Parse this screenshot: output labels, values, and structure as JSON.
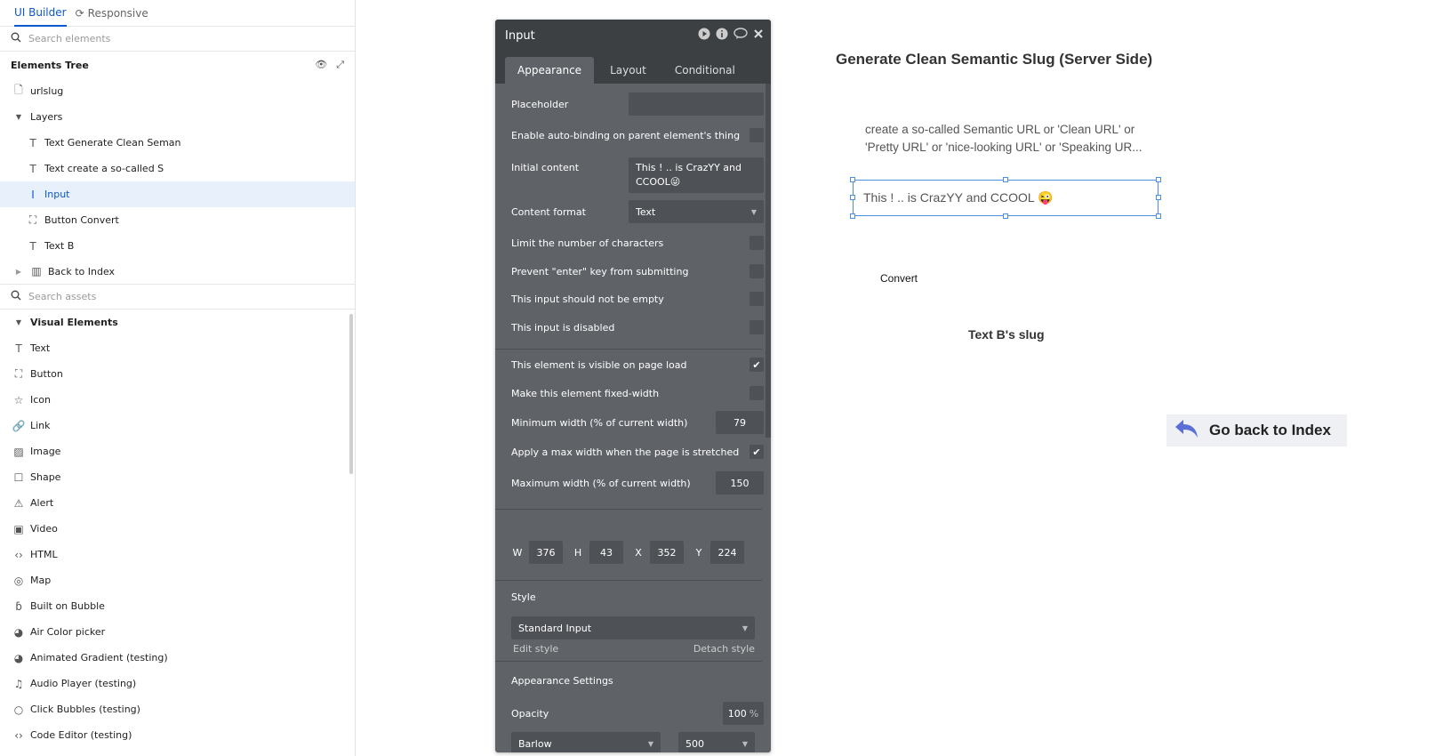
{
  "sidebar": {
    "tabs": [
      {
        "label": "UI Builder"
      },
      {
        "label": "Responsive"
      }
    ],
    "search_elements_placeholder": "Search elements",
    "tree_title": "Elements Tree",
    "tree": [
      {
        "label": "urlslug",
        "icon": "page-icon"
      },
      {
        "label": "Layers",
        "icon": "caret-down-icon"
      },
      {
        "label": "Text Generate Clean Seman",
        "icon": "text-icon"
      },
      {
        "label": "Text create a so-called S",
        "icon": "text-icon"
      },
      {
        "label": "Input",
        "icon": "input-cursor-icon"
      },
      {
        "label": "Button Convert",
        "icon": "button-icon"
      },
      {
        "label": "Text B",
        "icon": "text-icon"
      },
      {
        "label": "Back to Index",
        "icon": "group-icon"
      }
    ],
    "search_assets_placeholder": "Search assets",
    "visual_elements_title": "Visual Elements",
    "visual_elements": [
      {
        "label": "Text",
        "icon": "text-icon"
      },
      {
        "label": "Button",
        "icon": "button-icon"
      },
      {
        "label": "Icon",
        "icon": "star-icon"
      },
      {
        "label": "Link",
        "icon": "link-icon"
      },
      {
        "label": "Image",
        "icon": "image-icon"
      },
      {
        "label": "Shape",
        "icon": "shape-icon"
      },
      {
        "label": "Alert",
        "icon": "alert-icon"
      },
      {
        "label": "Video",
        "icon": "video-icon"
      },
      {
        "label": "HTML",
        "icon": "code-icon"
      },
      {
        "label": "Map",
        "icon": "map-pin-icon"
      },
      {
        "label": "Built on Bubble",
        "icon": "bubble-icon"
      },
      {
        "label": "Air Color picker",
        "icon": "palette-icon"
      },
      {
        "label": "Animated Gradient (testing)",
        "icon": "palette-icon"
      },
      {
        "label": "Audio Player (testing)",
        "icon": "music-icon"
      },
      {
        "label": "Click Bubbles (testing)",
        "icon": "circle-icon"
      },
      {
        "label": "Code Editor (testing)",
        "icon": "code-icon"
      }
    ]
  },
  "panel": {
    "title": "Input",
    "tabs": [
      {
        "label": "Appearance"
      },
      {
        "label": "Layout"
      },
      {
        "label": "Conditional"
      }
    ],
    "placeholder_label": "Placeholder",
    "placeholder_value": "",
    "autobinding_label": "Enable auto-binding on parent element's thing",
    "initial_content_label": "Initial content",
    "initial_content_value": "This ! .. is CrazYY and CCOOL😜",
    "content_format_label": "Content format",
    "content_format_value": "Text",
    "limit_chars_label": "Limit the number of characters",
    "prevent_enter_label": "Prevent \"enter\" key from submitting",
    "not_empty_label": "This input should not be empty",
    "disabled_label": "This input is disabled",
    "visible_label": "This element is visible on page load",
    "fixed_width_label": "Make this element fixed-width",
    "min_width_label": "Minimum width (% of current width)",
    "min_width_value": "79",
    "max_width_apply_label": "Apply a max width when the page is stretched",
    "max_width_label": "Maximum width (% of current width)",
    "max_width_value": "150",
    "w_label": "W",
    "w_value": "376",
    "h_label": "H",
    "h_value": "43",
    "x_label": "X",
    "x_value": "352",
    "y_label": "Y",
    "y_value": "224",
    "style_label": "Style",
    "style_value": "Standard Input",
    "edit_style": "Edit style",
    "detach_style": "Detach style",
    "appearance_settings_label": "Appearance Settings",
    "opacity_label": "Opacity",
    "opacity_value": "100",
    "opacity_unit": "%",
    "font_value": "Barlow",
    "font_weight_value": "500"
  },
  "canvas": {
    "title": "Generate Clean Semantic Slug (Server Side)",
    "description_line1": "create a so-called Semantic URL or 'Clean URL' or",
    "description_line2": "'Pretty URL' or 'nice-looking URL' or 'Speaking UR...",
    "input_value": "This ! .. is CrazYY and CCOOL 😜",
    "convert_label": "Convert",
    "slug_text": "Text B's slug",
    "back_label": "Go back to Index"
  },
  "colors": {
    "accent": "#0b57d0",
    "panel_bg": "#5f6368",
    "panel_header": "#3c4043",
    "selection": "#4a8fe0"
  }
}
